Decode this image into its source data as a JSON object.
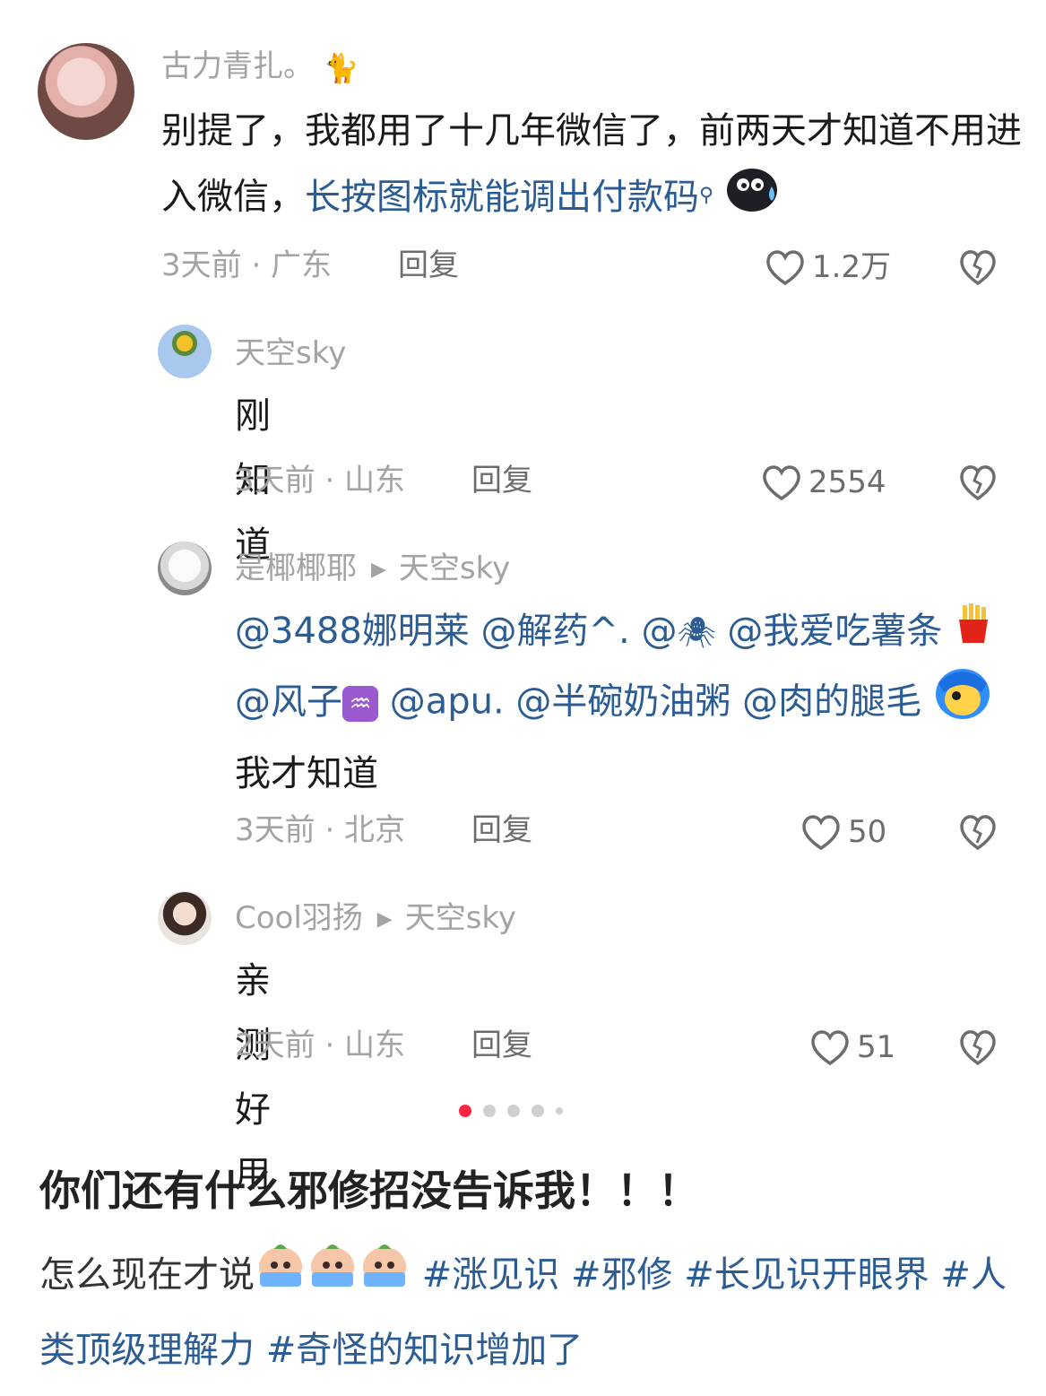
{
  "comments": [
    {
      "user": "古力青扎。",
      "text_plain": "别提了，我都用了十几年微信了，前两天才知道不用进入微信，",
      "text_link": "长按图标就能调出付款码",
      "time": "3天前 · 广东",
      "reply": "回复",
      "likes": "1.2万"
    },
    {
      "user": "天空sky",
      "text": "刚知道",
      "time": "3天前 · 山东",
      "reply": "回复",
      "likes": "2554"
    },
    {
      "user": "是椰椰耶",
      "reply_to": "天空sky",
      "mentions": [
        "@3488娜明莱",
        "@解药^.",
        "@",
        "@我爱吃薯条",
        "@风子",
        "@apu.",
        "@半碗奶油粥",
        "@肉的腿毛"
      ],
      "text_end": "我才知道",
      "time": "3天前 · 北京",
      "reply": "回复",
      "likes": "50"
    },
    {
      "user": "Cool羽扬",
      "reply_to": "天空sky",
      "text": "亲测好用",
      "time": "2天前 · 山东",
      "reply": "回复",
      "likes": "51"
    }
  ],
  "post": {
    "title": "你们还有什么邪修招没告诉我！！！",
    "body_prefix": "怎么现在才说",
    "tags": [
      "#涨见识",
      "#邪修",
      "#长见识开眼界",
      "#人类顶级理解力",
      "#奇怪的知识增加了"
    ]
  },
  "pager": {
    "pages": 5,
    "active": 1
  },
  "icons": [
    "heart-icon",
    "broken-heart-icon",
    "search-small-icon",
    "cat-emoji",
    "sweat-emoji",
    "spider-emoji",
    "fries-emoji",
    "aquarius-emoji",
    "blue-hair-emoji",
    "crying-peach-emoji"
  ],
  "colors": {
    "link": "#2b5c93",
    "meta": "#a3a3a3",
    "active_dot": "#ff2442"
  }
}
